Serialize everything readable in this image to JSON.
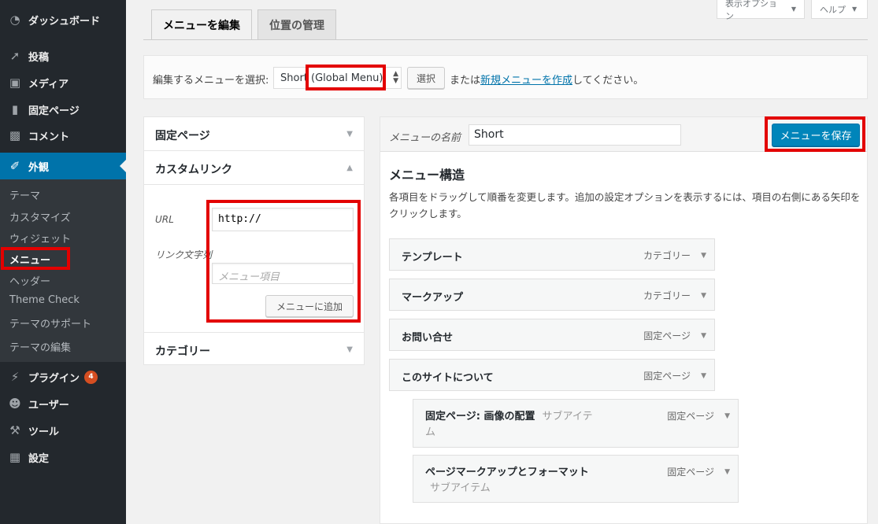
{
  "sidebar": {
    "items": [
      {
        "label": "ダッシュボード",
        "icon": "dashboard-icon"
      },
      {
        "label": "投稿",
        "icon": "pushpin-icon"
      },
      {
        "label": "メディア",
        "icon": "media-icon"
      },
      {
        "label": "固定ページ",
        "icon": "page-icon"
      },
      {
        "label": "コメント",
        "icon": "comment-icon"
      },
      {
        "label": "外観",
        "icon": "paintbrush-icon"
      },
      {
        "label": "プラグイン",
        "icon": "plugin-icon",
        "badge": "4"
      },
      {
        "label": "ユーザー",
        "icon": "user-icon"
      },
      {
        "label": "ツール",
        "icon": "wrench-icon"
      },
      {
        "label": "設定",
        "icon": "settings-icon"
      }
    ],
    "submenu": [
      "テーマ",
      "カスタマイズ",
      "ウィジェット",
      "メニュー",
      "ヘッダー",
      "Theme Check",
      "テーマのサポート",
      "テーマの編集"
    ]
  },
  "screen_options": {
    "label": "表示オプション",
    "help": "ヘルプ"
  },
  "tabs": {
    "edit": "メニューを編集",
    "locations": "位置の管理"
  },
  "manage": {
    "select_label": "編集するメニューを選択:",
    "selected_menu": "Short (Global Menu)",
    "select_button": "選択",
    "or_text_before": "または",
    "create_link": "新規メニューを作成",
    "or_text_after": "してください。"
  },
  "accordion": {
    "pages": "固定ページ",
    "custom_links": "カスタムリンク",
    "categories": "カテゴリー",
    "url_label": "URL",
    "url_value": "http://",
    "link_text_label": "リンク文字列",
    "link_text_placeholder": "メニュー項目",
    "add_button": "メニューに追加"
  },
  "menu": {
    "name_label": "メニューの名前",
    "name_value": "Short",
    "save_button": "メニューを保存",
    "structure_title": "メニュー構造",
    "instructions": "各項目をドラッグして順番を変更します。追加の設定オプションを表示するには、項目の右側にある矢印をクリックします。",
    "items": [
      {
        "title": "テンプレート",
        "type": "カテゴリー"
      },
      {
        "title": "マークアップ",
        "type": "カテゴリー"
      },
      {
        "title": "お問い合せ",
        "type": "固定ページ"
      },
      {
        "title": "このサイトについて",
        "type": "固定ページ"
      },
      {
        "title": "固定ページ: 画像の配置",
        "sub_label_1": "サブアイテ",
        "sub_label_2": "ム",
        "type": "固定ページ"
      },
      {
        "title": "ページマークアップとフォーマット",
        "sub_label": "サブアイテム",
        "type": "固定ページ"
      }
    ]
  },
  "colors": {
    "accent": "#0073aa",
    "annotation": "#e30000"
  }
}
